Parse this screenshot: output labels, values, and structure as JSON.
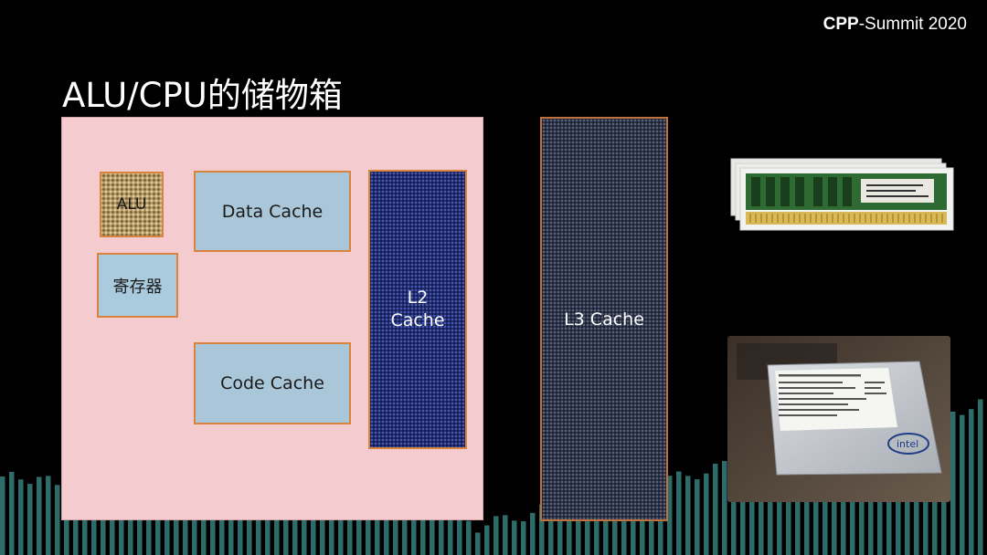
{
  "header": {
    "brand_bold": "CPP",
    "brand_rest": "-Summit 2020"
  },
  "title": "ALU/CPU的储物箱",
  "diagram": {
    "alu_label": "ALU",
    "registers_label": "寄存器",
    "data_cache_label": "Data Cache",
    "code_cache_label": "Code Cache",
    "l2_line1": "L2",
    "l2_line2": "Cache",
    "l3_label": "L3 Cache"
  },
  "images": {
    "ram_icon": "ram-modules",
    "ssd_icon": "intel-ssd",
    "ssd_label": "Intel SSD DC S3700 Series 100GB",
    "ssd_logo": "intel"
  },
  "colors": {
    "background": "#000000",
    "cpu_die": "#f4cbcf",
    "cache_block": "#a9c7d8",
    "block_border": "#d9843c",
    "l2": "#1e2a6e",
    "l3": "#2b3148",
    "bars": "#2f6b68"
  }
}
